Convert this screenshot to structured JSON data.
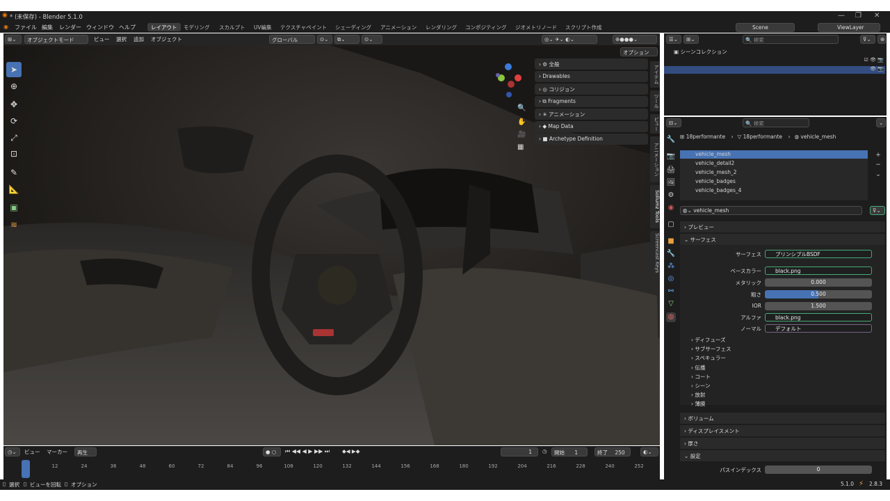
{
  "app": {
    "title": "* (未保存) - Blender 5.1.0"
  },
  "menu": {
    "items": [
      "ファイル",
      "編集",
      "レンダー",
      "ウィンドウ",
      "ヘルプ"
    ]
  },
  "workspaces": [
    "レイアウト",
    "モデリング",
    "スカルプト",
    "UV編集",
    "テクスチャペイント",
    "シェーディング",
    "アニメーション",
    "レンダリング",
    "コンポジティング",
    "ジオメトリノード",
    "スクリプト作成"
  ],
  "topright": {
    "scene": "Scene",
    "viewlayer": "ViewLayer"
  },
  "viewport_header": {
    "mode": "オブジェクトモード",
    "view": "ビュー",
    "select": "選択",
    "add": "追加",
    "object": "オブジェクト",
    "orientation": "グローバル",
    "options": "オプション"
  },
  "npanel": {
    "items": [
      "全般",
      "Drawables",
      "コリジョン",
      "Fragments",
      "アニメーション",
      "Map Data",
      "Archetype Definition"
    ],
    "tabs": [
      "アイテム",
      "ツール",
      "ビュー",
      "アニメーション",
      "Sollumz Tools",
      "Screencast Keys"
    ]
  },
  "outliner": {
    "search_placeholder": "検索",
    "root": "シーンコレクション"
  },
  "properties": {
    "search_placeholder": "検索",
    "breadcrumb": [
      "18performante",
      "18performante",
      "vehicle_mesh"
    ],
    "materials": [
      "vehicle_mesh",
      "vehicle_detail2",
      "vehicle_mesh_2",
      "vehicle_badges",
      "vehicle_badges_4"
    ],
    "material_name": "vehicle_mesh",
    "sections": {
      "preview": "プレビュー",
      "surface": "サーフェス",
      "volume": "ボリューム",
      "displacement": "ディスプレイスメント",
      "thickness": "厚さ",
      "settings": "設定"
    },
    "surface": {
      "surface_label": "サーフェス",
      "surface_value": "プリンシプルBSDF",
      "basecolor_label": "ベースカラー",
      "basecolor_value": "black.png",
      "metallic_label": "メタリック",
      "metallic_value": "0.000",
      "roughness_label": "粗さ",
      "roughness_value": "0.500",
      "ior_label": "IOR",
      "ior_value": "1.500",
      "alpha_label": "アルファ",
      "alpha_value": "black.png",
      "normal_label": "ノーマル",
      "normal_value": "デフォルト"
    },
    "subpanels": [
      "ディフューズ",
      "サブサーフェス",
      "スペキュラー",
      "伝播",
      "コート",
      "シーン",
      "放射",
      "薄膜"
    ],
    "pass_index_label": "パスインデックス",
    "pass_index_value": "0"
  },
  "timeline": {
    "view": "ビュー",
    "marker": "マーカー",
    "playback": "再生",
    "current_frame": "1",
    "start_label": "開始",
    "start": "1",
    "end_label": "終了",
    "end": "250",
    "ticks": [
      "1",
      "12",
      "24",
      "36",
      "48",
      "60",
      "72",
      "84",
      "96",
      "108",
      "120",
      "132",
      "144",
      "156",
      "168",
      "180",
      "192",
      "204",
      "216",
      "228",
      "240",
      "252"
    ]
  },
  "status": {
    "select": "選択",
    "rotate": "ビューを回転",
    "options": "オプション",
    "version": "5.1.0",
    "fps": "2.8.3"
  }
}
